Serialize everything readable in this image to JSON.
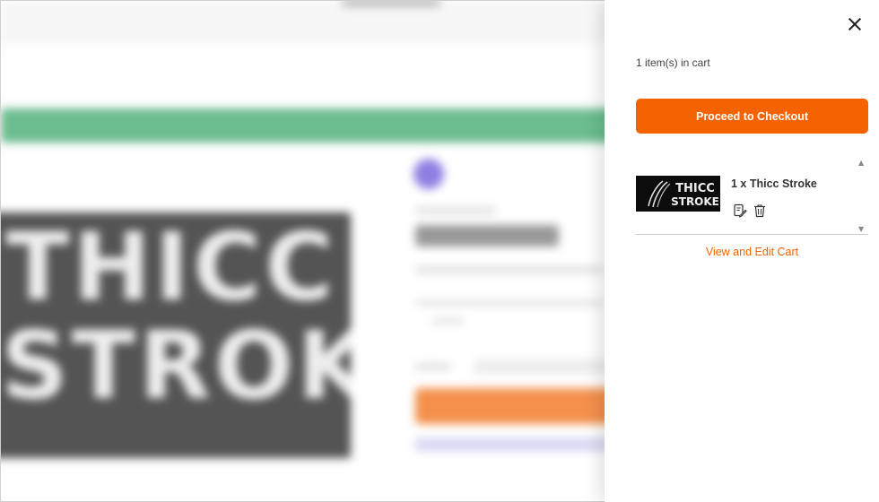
{
  "cart": {
    "count_text": "1 item(s) in cart",
    "checkout_label": "Proceed to Checkout",
    "items": [
      {
        "quantity_name": "1 x Thicc Stroke",
        "thumbnail_text": "THICC STROKE"
      }
    ],
    "view_edit_label": "View and Edit Cart",
    "scroll_up_glyph": "▲",
    "scroll_down_glyph": "▼"
  },
  "background": {
    "product_image_text": "THICC STROKE",
    "colors": {
      "accent": "#f56300",
      "banner": "#3aa76a",
      "avatar": "#6a55d8"
    }
  }
}
